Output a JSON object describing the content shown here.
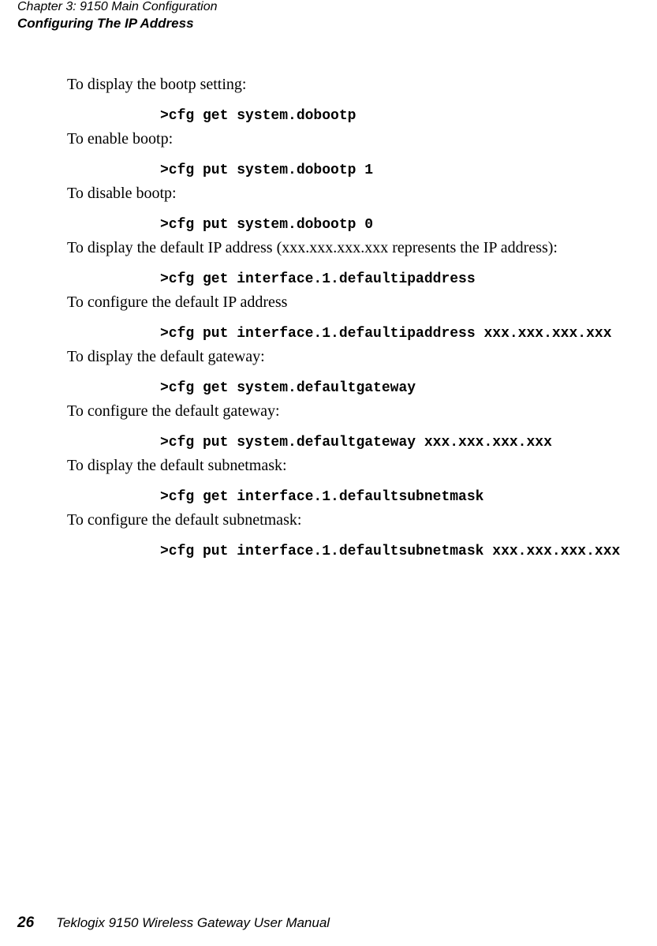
{
  "header": {
    "chapter": "Chapter 3:  9150 Main Configuration",
    "section": "Configuring The IP Address"
  },
  "items": [
    {
      "desc": "To display the bootp setting:",
      "cmd": ">cfg get system.dobootp"
    },
    {
      "desc": "To enable bootp:",
      "cmd": ">cfg put system.dobootp 1"
    },
    {
      "desc": "To disable bootp:",
      "cmd": ">cfg put system.dobootp 0"
    },
    {
      "desc": "To display the default IP address (xxx.xxx.xxx.xxx represents the IP address):",
      "cmd": ">cfg get interface.1.defaultipaddress"
    },
    {
      "desc": "To configure the default IP address",
      "cmd": ">cfg put interface.1.defaultipaddress xxx.xxx.xxx.xxx"
    },
    {
      "desc": "To display the default gateway:",
      "cmd": ">cfg get system.defaultgateway"
    },
    {
      "desc": "To configure the default gateway:",
      "cmd": ">cfg put system.defaultgateway xxx.xxx.xxx.xxx"
    },
    {
      "desc": "To display the default subnetmask:",
      "cmd": ">cfg get interface.1.defaultsubnetmask"
    },
    {
      "desc": "To configure the default subnetmask:",
      "cmd": ">cfg put interface.1.defaultsubnetmask xxx.xxx.xxx.xxx"
    }
  ],
  "footer": {
    "page": "26",
    "title": "Teklogix 9150 Wireless Gateway User Manual"
  }
}
